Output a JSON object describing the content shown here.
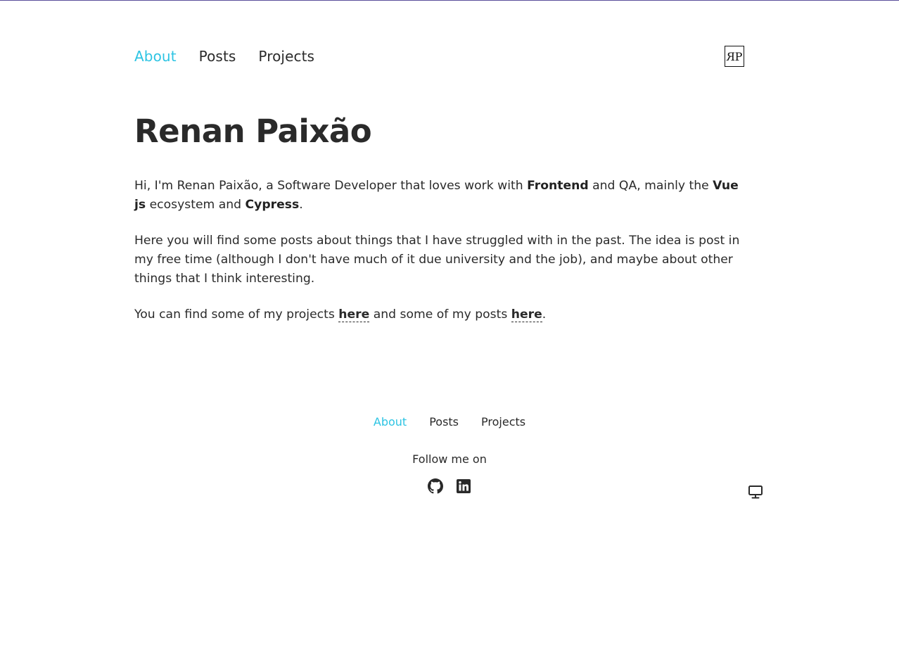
{
  "header": {
    "nav": [
      {
        "label": "About",
        "active": true
      },
      {
        "label": "Posts",
        "active": false
      },
      {
        "label": "Projects",
        "active": false
      }
    ],
    "logo_text": "RP"
  },
  "main": {
    "title": "Renan Paixão",
    "intro": {
      "p1_a": "Hi, I'm Renan Paixão, a Software Developer that loves work with ",
      "p1_b": "Frontend",
      "p1_c": " and QA, mainly the ",
      "p1_d": "Vue js",
      "p1_e": " ecosystem and ",
      "p1_f": "Cypress",
      "p1_g": "."
    },
    "p2": "Here you will find some posts about things that I have struggled with in the past. The idea is post in my free time (although I don't have much of it due university and the job), and maybe about other things that I think interesting.",
    "p3": {
      "a": "You can find some of my projects ",
      "link1": "here",
      "b": " and some of my posts ",
      "link2": "here",
      "c": "."
    }
  },
  "footer": {
    "nav": [
      {
        "label": "About",
        "active": true
      },
      {
        "label": "Posts",
        "active": false
      },
      {
        "label": "Projects",
        "active": false
      }
    ],
    "follow_text": "Follow me on",
    "socials": [
      "github-icon",
      "linkedin-icon"
    ],
    "theme_icon": "monitor-icon"
  },
  "colors": {
    "accent": "#2dc4e3",
    "text": "#2a2a2a",
    "topline": "#5a4f9a"
  }
}
